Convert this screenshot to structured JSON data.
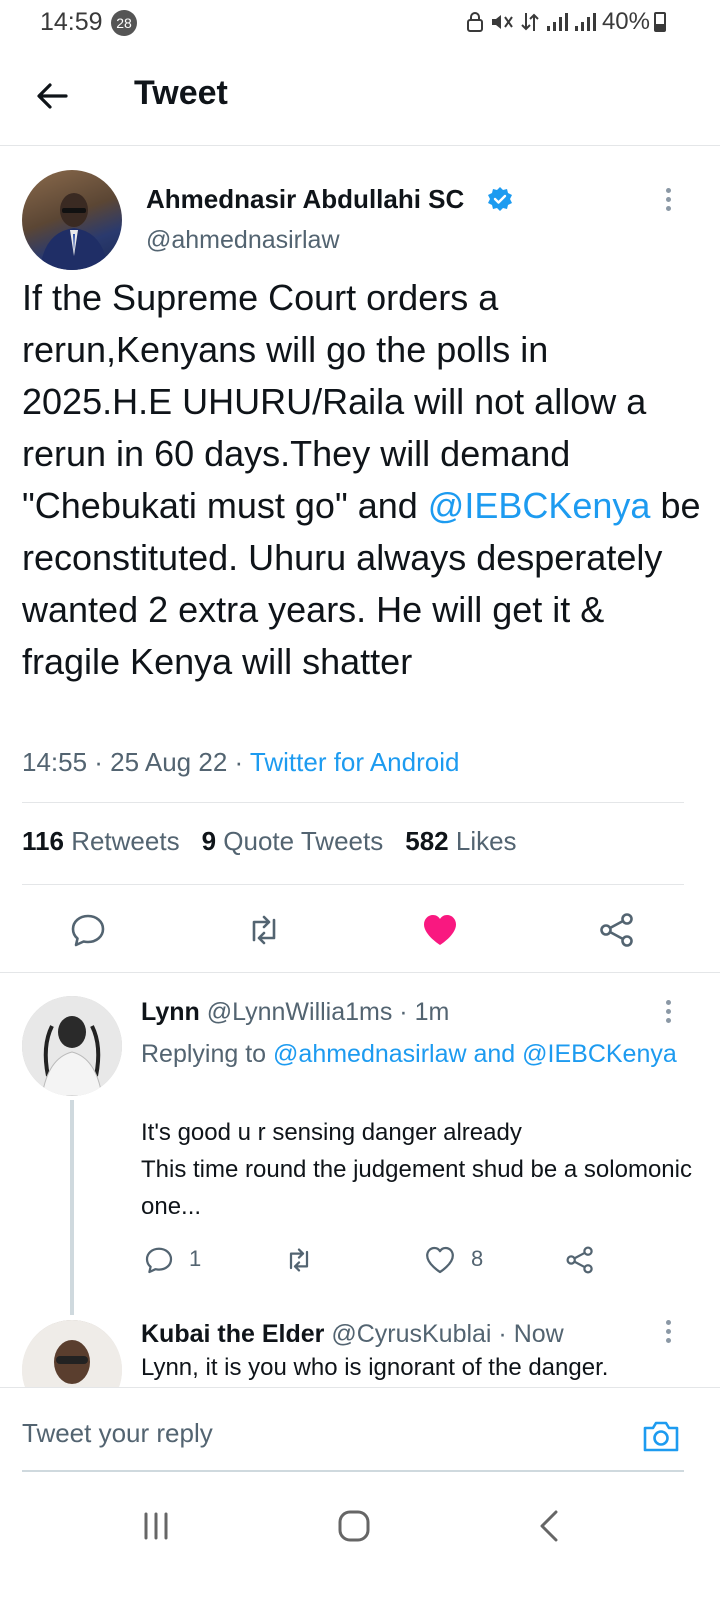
{
  "status_bar": {
    "time": "14:59",
    "notification_count": "28",
    "battery": "40%",
    "battery_level": 0.4
  },
  "header": {
    "title": "Tweet"
  },
  "tweet": {
    "author_name": "Ahmednasir Abdullahi SC",
    "author_handle": "@ahmednasirlaw",
    "text_before_mention": "If the Supreme Court orders a rerun,Kenyans will go the polls in 2025.H.E UHURU/Raila will not allow a rerun in 60 days.They will demand \"Chebukati must go\" and ",
    "mention": "@IEBCKenya",
    "text_after_mention": " be reconstituted. Uhuru always desperately wanted 2 extra years. He will get it & fragile Kenya will shatter",
    "timestamp": "14:55 · 25 Aug 22 · ",
    "source": "Twitter for Android",
    "stats": {
      "retweets_count": "116",
      "retweets_label": "Retweets",
      "quotes_count": "9",
      "quotes_label": "Quote Tweets",
      "likes_count": "582",
      "likes_label": "Likes"
    },
    "liked": true
  },
  "replies": [
    {
      "name": "Lynn",
      "handle": "@LynnWillia1ms · 1m",
      "replying_prefix": "Replying to ",
      "replying_to": "@ahmednasirlaw and @IEBCKenya",
      "text_line1": "It's good u r sensing danger already",
      "text_line2": "This time round the judgement shud be a solomonic one...",
      "reply_count": "1",
      "like_count": "8"
    },
    {
      "name": "Kubai the Elder",
      "handle": "@CyrusKublai · Now",
      "text": "Lynn, it is you who is ignorant of the danger."
    }
  ],
  "composer": {
    "placeholder": "Tweet your reply"
  },
  "colors": {
    "accent": "#1d9bf0",
    "like": "#f91880",
    "text": "#0f1419",
    "secondary": "#536471"
  }
}
